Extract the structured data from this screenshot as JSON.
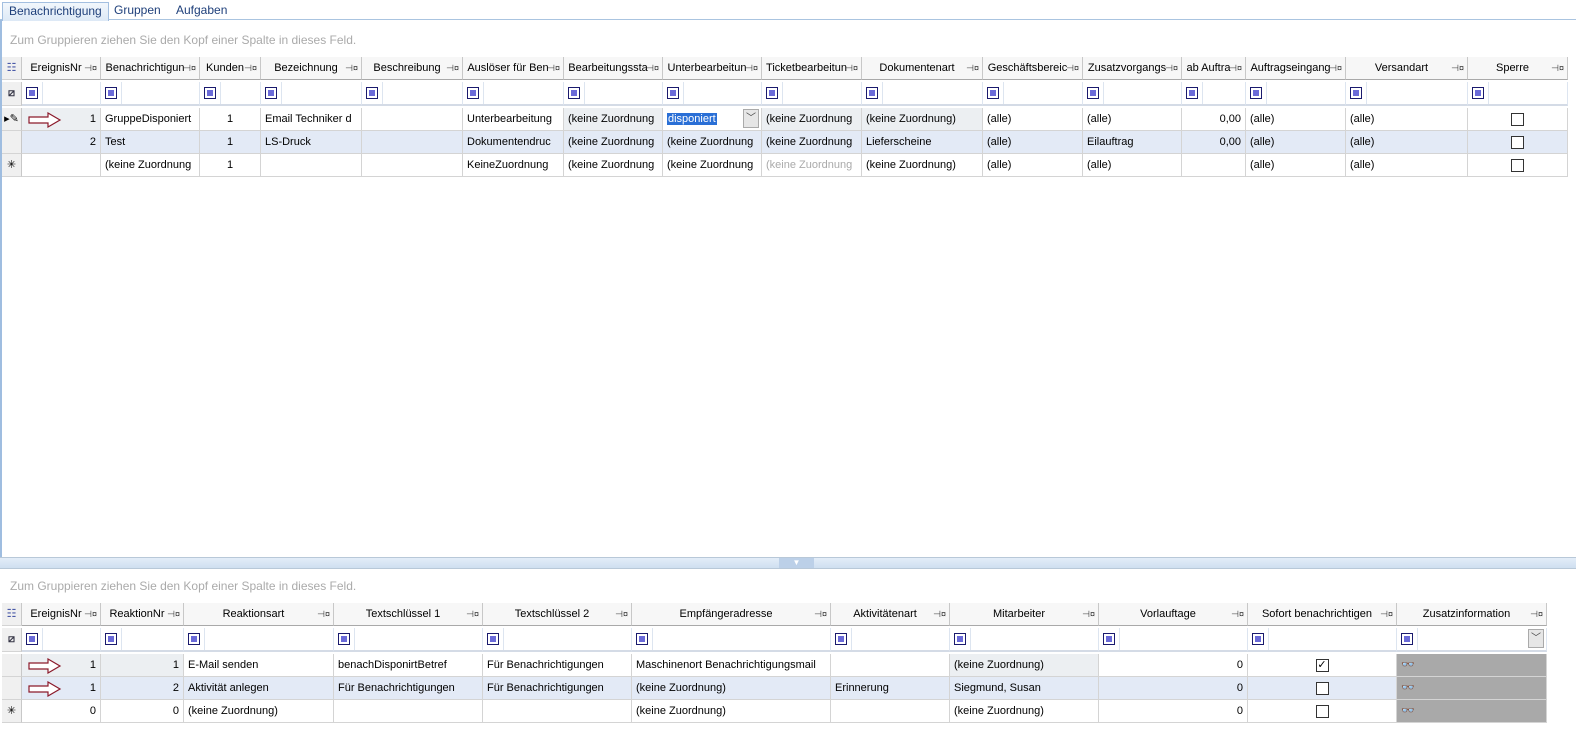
{
  "tabs": [
    {
      "label": "Benachrichtigung",
      "active": true
    },
    {
      "label": "Gruppen",
      "active": false
    },
    {
      "label": "Aufgaben",
      "active": false
    }
  ],
  "group_hint": "Zum Gruppieren ziehen Sie den Kopf einer Spalte in dieses Feld.",
  "colors": {
    "accent": "#2a6fd6",
    "row_alt": "#e3eaf6",
    "row_dim": "#eceff2",
    "arrow": "#8b1a2b",
    "binoculars_bg": "#a9a9a9"
  },
  "top_grid": {
    "columns": [
      "EreignisNr",
      "Benachrichtigun",
      "Kunden",
      "Bezeichnung",
      "Beschreibung",
      "Auslöser für Ben",
      "Bearbeitungssta",
      "Unterbearbeitun",
      "Ticketbearbeitun",
      "Dokumentenart",
      "Geschäftsbereic",
      "Zusatzvorgangs",
      "ab Auftra",
      "Auftragseingang",
      "Versandart",
      "Sperre"
    ],
    "rows": [
      {
        "indicator": "edit-pencil-icon",
        "arrow": true,
        "cells": [
          "1",
          "GruppeDisponiert",
          "1",
          "Email Techniker d",
          "",
          "Unterbearbeitung",
          "(keine Zuordnung",
          "disponiert",
          "(keine Zuordnung",
          "(keine Zuordnung)",
          "(alle)",
          "(alle)",
          "0,00",
          "(alle)",
          "(alle)",
          false
        ]
      },
      {
        "indicator": "",
        "arrow": false,
        "cells": [
          "2",
          "Test",
          "1",
          "LS-Druck",
          "",
          "Dokumentendruc",
          "(keine Zuordnung",
          "(keine Zuordnung",
          "(keine Zuordnung",
          "Lieferscheine",
          "(alle)",
          "Eilauftrag",
          "0,00",
          "(alle)",
          "(alle)",
          false
        ]
      },
      {
        "indicator": "new-row-asterisk-icon",
        "arrow": false,
        "cells": [
          "",
          "(keine Zuordnung",
          "1",
          "",
          "",
          "KeineZuordnung",
          "(keine Zuordnung",
          "(keine Zuordnung",
          "(keine Zuordnung",
          "(keine Zuordnung)",
          "(alle)",
          "(alle)",
          "",
          "(alle)",
          "(alle)",
          false
        ]
      }
    ]
  },
  "bottom_grid": {
    "columns": [
      "EreignisNr",
      "ReaktionNr",
      "Reaktionsart",
      "Textschlüssel 1",
      "Textschlüssel 2",
      "Empfängeradresse",
      "Aktivitätenart",
      "Mitarbeiter",
      "Vorlauftage",
      "Sofort benachrichtigen",
      "Zusatzinformation"
    ],
    "rows": [
      {
        "indicator": "",
        "arrow": true,
        "cells": [
          "1",
          "1",
          "E-Mail senden",
          "benachDisponirtBetref",
          "Für Benachrichtigungen",
          "Maschinenort Benachrichtigungsmail",
          "",
          "(keine Zuordnung)",
          "0",
          true,
          "binoculars"
        ]
      },
      {
        "indicator": "",
        "arrow": true,
        "cells": [
          "1",
          "2",
          "Aktivität anlegen",
          "Für Benachrichtigungen",
          "Für Benachrichtigungen",
          "(keine Zuordnung)",
          "Erinnerung",
          "Siegmund, Susan",
          "0",
          false,
          "binoculars"
        ]
      },
      {
        "indicator": "new-row-asterisk-icon",
        "arrow": false,
        "cells": [
          "0",
          "0",
          "(keine Zuordnung)",
          "",
          "",
          "(keine Zuordnung)",
          "",
          "(keine Zuordnung)",
          "0",
          false,
          "binoculars"
        ]
      }
    ]
  }
}
